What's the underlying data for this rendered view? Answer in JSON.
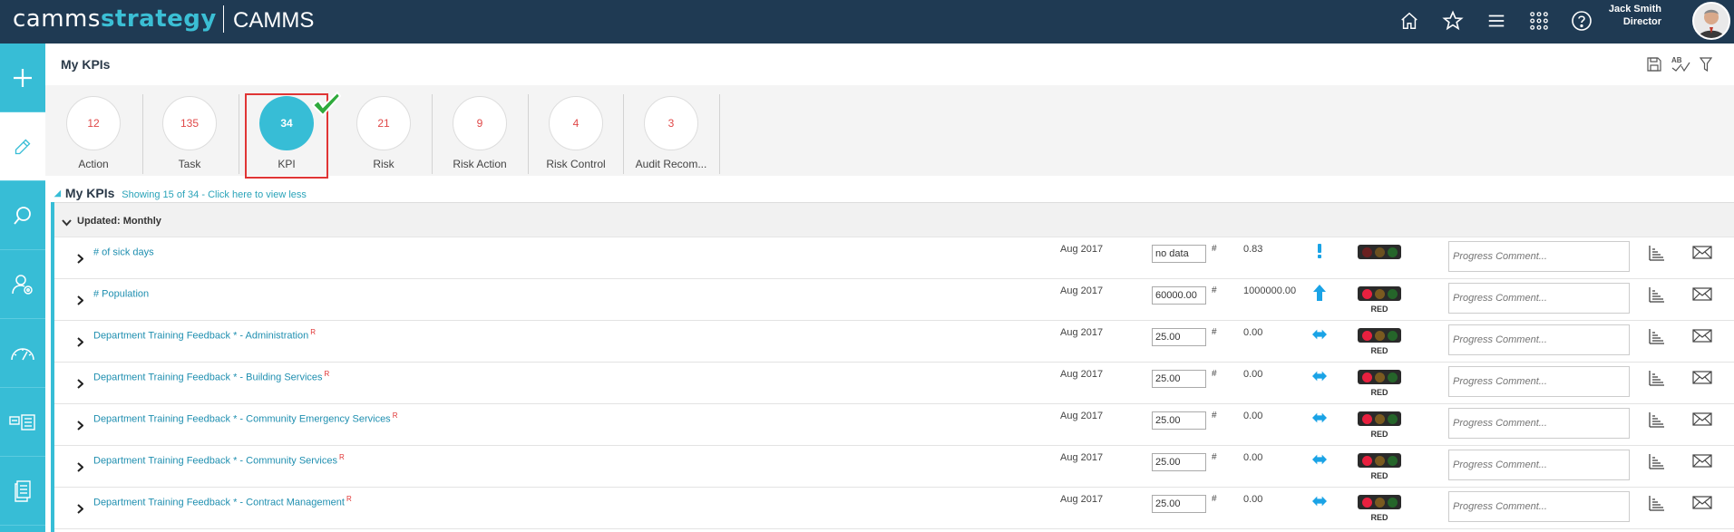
{
  "header": {
    "logo_part1": "camms",
    "logo_part2": "strategy",
    "brand": "CAMMS",
    "user_name": "Jack Smith",
    "user_role": "Director"
  },
  "page": {
    "title": "My KPIs"
  },
  "counters": [
    {
      "count": "12",
      "label": "Action"
    },
    {
      "count": "135",
      "label": "Task"
    },
    {
      "count": "34",
      "label": "KPI"
    },
    {
      "count": "21",
      "label": "Risk"
    },
    {
      "count": "9",
      "label": "Risk Action"
    },
    {
      "count": "4",
      "label": "Risk Control"
    },
    {
      "count": "3",
      "label": "Audit Recom..."
    }
  ],
  "section": {
    "title": "My KPIs",
    "summary": "Showing 15 of 34 - Click here to view less"
  },
  "group": {
    "label": "Updated: Monthly"
  },
  "rows": [
    {
      "name": "# of sick days",
      "flag": "",
      "period": "Aug 2017",
      "actual": "no data",
      "unit": "#",
      "target": "0.83",
      "trend": "alert",
      "rag": ""
    },
    {
      "name": "# Population",
      "flag": "",
      "period": "Aug 2017",
      "actual": "60000.00",
      "unit": "#",
      "target": "1000000.00",
      "trend": "up",
      "rag": "RED"
    },
    {
      "name": "Department Training Feedback * - Administration",
      "flag": "R",
      "period": "Aug 2017",
      "actual": "25.00",
      "unit": "#",
      "target": "0.00",
      "trend": "flat",
      "rag": "RED"
    },
    {
      "name": "Department Training Feedback * - Building Services",
      "flag": "R",
      "period": "Aug 2017",
      "actual": "25.00",
      "unit": "#",
      "target": "0.00",
      "trend": "flat",
      "rag": "RED"
    },
    {
      "name": "Department Training Feedback * - Community Emergency Services",
      "flag": "R",
      "period": "Aug 2017",
      "actual": "25.00",
      "unit": "#",
      "target": "0.00",
      "trend": "flat",
      "rag": "RED"
    },
    {
      "name": "Department Training Feedback * - Community Services",
      "flag": "R",
      "period": "Aug 2017",
      "actual": "25.00",
      "unit": "#",
      "target": "0.00",
      "trend": "flat",
      "rag": "RED"
    },
    {
      "name": "Department Training Feedback * - Contract Management",
      "flag": "R",
      "period": "Aug 2017",
      "actual": "25.00",
      "unit": "#",
      "target": "0.00",
      "trend": "flat",
      "rag": "RED"
    }
  ],
  "comment_placeholder": "Progress Comment...",
  "colors": {
    "topbar": "#1f3a53",
    "accent": "#37bdd6",
    "link": "#1f8fb0",
    "red": "#e03535"
  }
}
